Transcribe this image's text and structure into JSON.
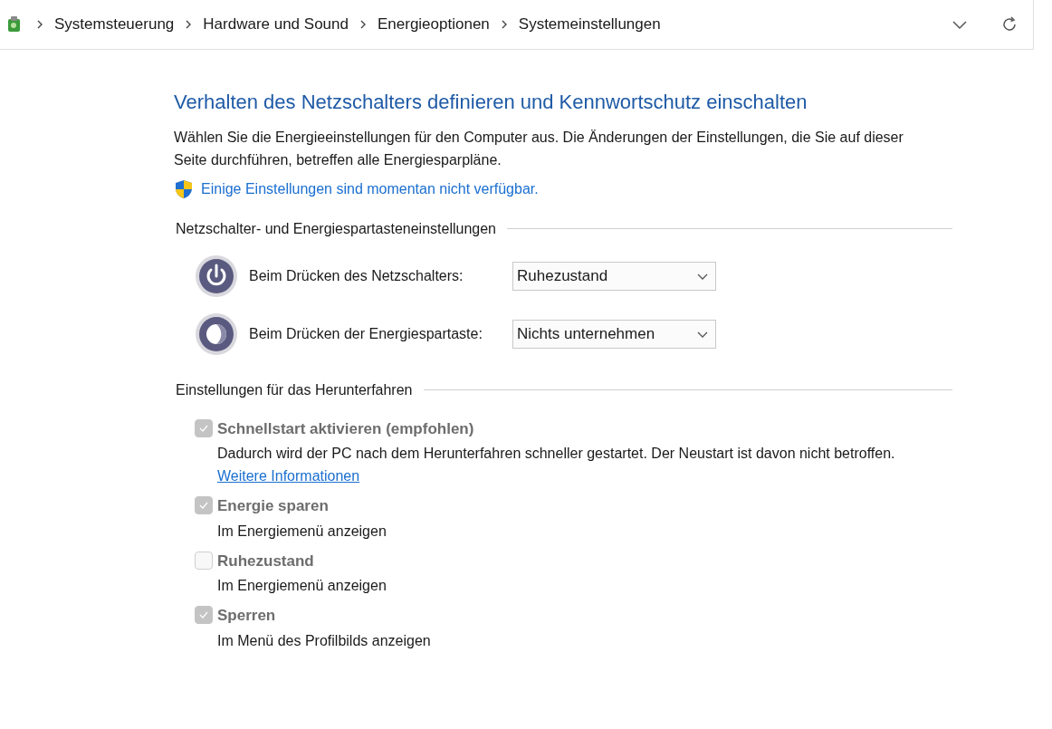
{
  "address_bar": {
    "breadcrumbs": [
      "Systemsteuerung",
      "Hardware und Sound",
      "Energieoptionen",
      "Systemeinstellungen"
    ]
  },
  "title": "Verhalten des Netzschalters definieren und Kennwortschutz einschalten",
  "intro": "Wählen Sie die Energieeinstellungen für den Computer aus. Die Änderungen der Einstellungen, die Sie auf dieser Seite durchführen, betreffen alle Energiesparpläne.",
  "admin_link": "Einige Einstellungen sind momentan nicht verfügbar.",
  "button_section": {
    "heading": "Netzschalter- und Energiespartasteneinstellungen",
    "rows": [
      {
        "kind": "power",
        "label": "Beim Drücken des Netzschalters:",
        "value": "Ruhezustand"
      },
      {
        "kind": "sleep",
        "label": "Beim Drücken der Energiespartaste:",
        "value": "Nichts unternehmen"
      }
    ]
  },
  "shutdown_section": {
    "heading": "Einstellungen für das Herunterfahren",
    "options": [
      {
        "label": "Schnellstart aktivieren (empfohlen)",
        "checked": true,
        "disabled": true,
        "description": "Dadurch wird der PC nach dem Herunterfahren schneller gestartet. Der Neustart ist davon nicht betroffen.",
        "link": "Weitere Informationen"
      },
      {
        "label": "Energie sparen",
        "checked": true,
        "disabled": true,
        "description": "Im Energiemenü anzeigen"
      },
      {
        "label": "Ruhezustand",
        "checked": false,
        "disabled": true,
        "description": "Im Energiemenü anzeigen"
      },
      {
        "label": "Sperren",
        "checked": true,
        "disabled": true,
        "description": "Im Menü des Profilbilds anzeigen"
      }
    ]
  }
}
